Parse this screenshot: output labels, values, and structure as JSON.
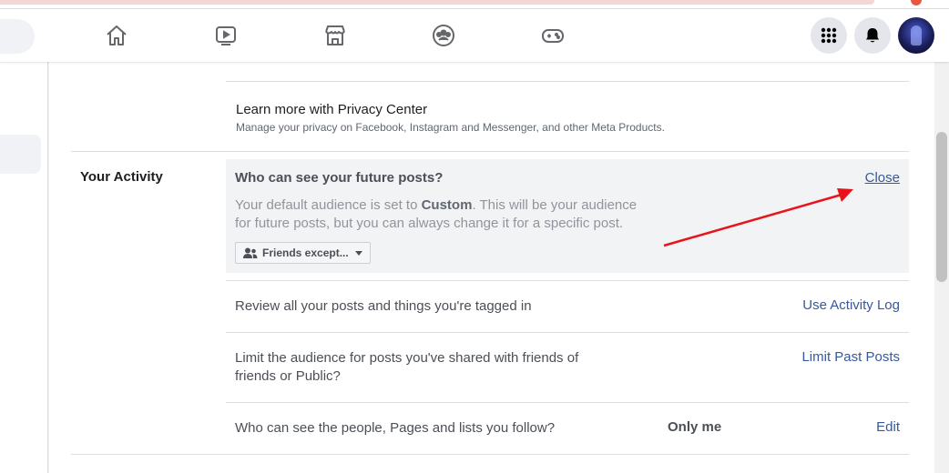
{
  "nav": {
    "icons": [
      "home-icon",
      "watch-icon",
      "marketplace-icon",
      "groups-icon",
      "gaming-icon"
    ],
    "right_icons": [
      "menu-grid-icon",
      "notifications-bell-icon",
      "avatar"
    ]
  },
  "privacy_center": {
    "title": "Learn more with Privacy Center",
    "subtitle": "Manage your privacy on Facebook, Instagram and Messenger, and other Meta Products."
  },
  "your_activity": {
    "section_title": "Your Activity",
    "expanded": {
      "question": "Who can see your future posts?",
      "close_label": "Close",
      "desc_prefix": "Your default audience is set to ",
      "desc_bold": "Custom",
      "desc_suffix": ". This will be your audience for future posts, but you can always change it for a specific post.",
      "audience_button": "Friends except..."
    },
    "rows": [
      {
        "text": "Review all your posts and things you're tagged in",
        "link": "Use Activity Log"
      },
      {
        "text_line1": "Limit the audience for posts you've shared with friends of",
        "text_line2": "friends or Public?",
        "link": "Limit Past Posts"
      },
      {
        "text": "Who can see the people, Pages and lists you follow?",
        "value": "Only me",
        "link": "Edit"
      }
    ]
  },
  "colors": {
    "link": "#385898",
    "annotation_arrow": "#e8141c",
    "expanded_bg": "#f2f3f5"
  }
}
